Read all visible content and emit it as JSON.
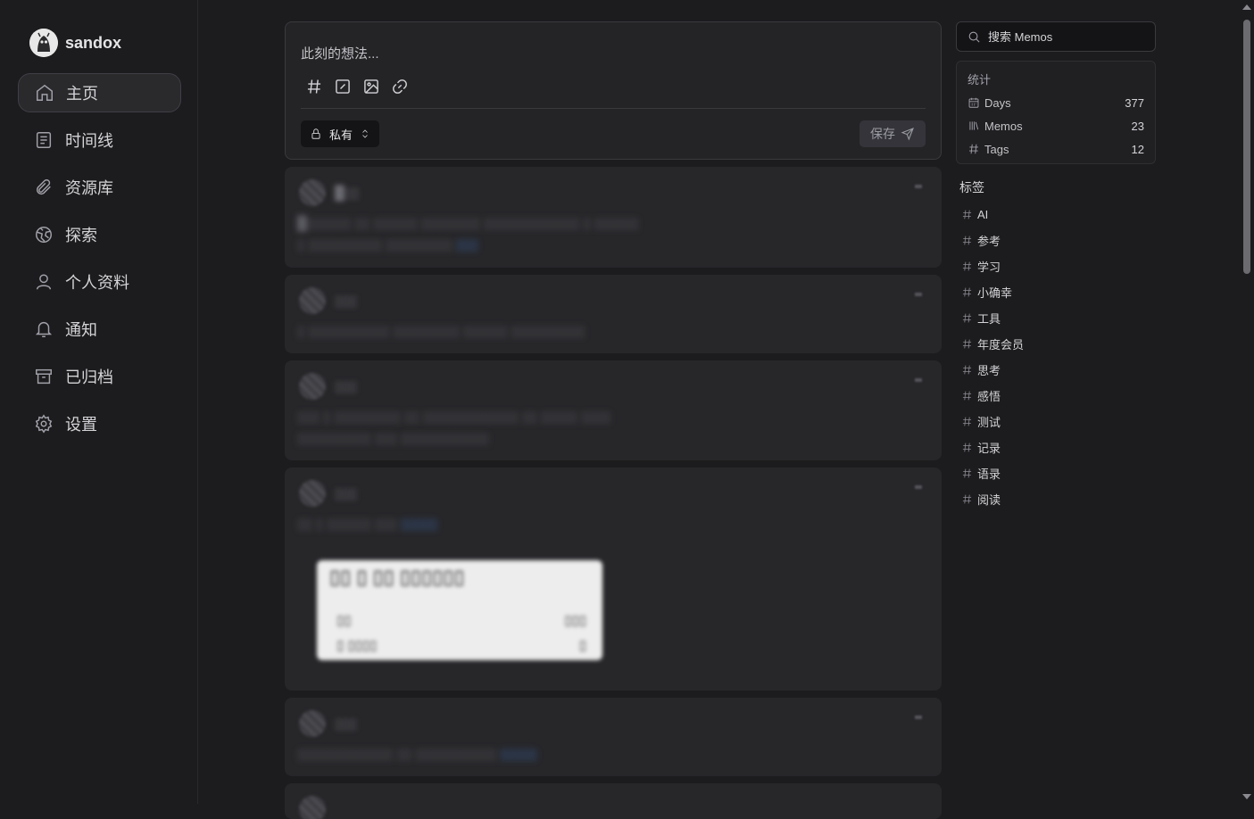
{
  "app": {
    "name": "sandox"
  },
  "nav": [
    {
      "label": "主页",
      "icon": "home-icon",
      "active": true
    },
    {
      "label": "时间线",
      "icon": "timeline-icon",
      "active": false
    },
    {
      "label": "资源库",
      "icon": "paperclip-icon",
      "active": false
    },
    {
      "label": "探索",
      "icon": "globe-icon",
      "active": false
    },
    {
      "label": "个人资料",
      "icon": "user-icon",
      "active": false
    },
    {
      "label": "通知",
      "icon": "bell-icon",
      "active": false
    },
    {
      "label": "已归档",
      "icon": "archive-icon",
      "active": false
    },
    {
      "label": "设置",
      "icon": "gear-icon",
      "active": false
    }
  ],
  "editor": {
    "placeholder": "此刻的想法...",
    "visibility": "私有",
    "save_label": "保存"
  },
  "memos": [
    {
      "name": "█▯▯",
      "text": "█▯▯▯▯▯▯ ▯▯ ▯▯▯▯▯▯ ▯▯▯▯▯▯▯▯ ▯▯▯▯▯▯▯▯▯▯▯▯▯ ▯ ▯▯▯▯▯▯",
      "text2": "▯ ▯▯▯▯▯▯▯▯▯▯ ▯▯▯▯▯▯▯▯▯ ",
      "link": "▯▯▯"
    },
    {
      "name": "▯▯▯",
      "text": "▯ ▯▯▯▯▯▯▯▯▯▯▯ ▯▯▯▯▯▯▯▯▯ ▯▯▯▯▯▯ ▯▯▯▯▯▯▯▯▯▯",
      "text2": "",
      "link": ""
    },
    {
      "name": "▯▯▯",
      "text": "▯▯▯ ▯ ▯▯▯▯▯▯▯▯▯ ▯▯ ▯▯▯▯▯▯▯▯▯▯▯▯▯ ▯▯ ▯▯▯▯▯ ▯▯▯▯",
      "text2": "▯▯▯▯▯▯▯▯▯▯ ▯▯▯ ▯▯▯▯▯▯▯▯▯▯▯▯",
      "link": ""
    },
    {
      "name": "▯▯▯",
      "text": "▯▯ ▯ ▯▯▯▯▯▯ ▯▯▯ ",
      "text2": "",
      "link": "▯▯▯▯▯",
      "image": {
        "title": "▯▯ ▯ ▯▯ ▯▯▯▯▯▯",
        "row1": "▯▯",
        "val1": "▯▯▯",
        "row2": "▯ ▯▯▯▯",
        "val2": "▯"
      }
    },
    {
      "name": "▯▯▯",
      "text": "▯▯▯▯▯▯▯▯▯▯▯▯▯ ▯▯ ▯▯▯▯▯▯▯▯▯▯▯ ",
      "text2": "",
      "link": "▯▯▯▯▯"
    }
  ],
  "search": {
    "placeholder": "搜索 Memos"
  },
  "stats": {
    "title": "统计",
    "rows": [
      {
        "label": "Days",
        "value": "377",
        "icon": "calendar-icon"
      },
      {
        "label": "Memos",
        "value": "23",
        "icon": "library-icon"
      },
      {
        "label": "Tags",
        "value": "12",
        "icon": "hash-icon"
      }
    ]
  },
  "tags": {
    "title": "标签",
    "items": [
      "AI",
      "参考",
      "学习",
      "小确幸",
      "工具",
      "年度会员",
      "思考",
      "感悟",
      "测试",
      "记录",
      "语录",
      "阅读"
    ]
  }
}
